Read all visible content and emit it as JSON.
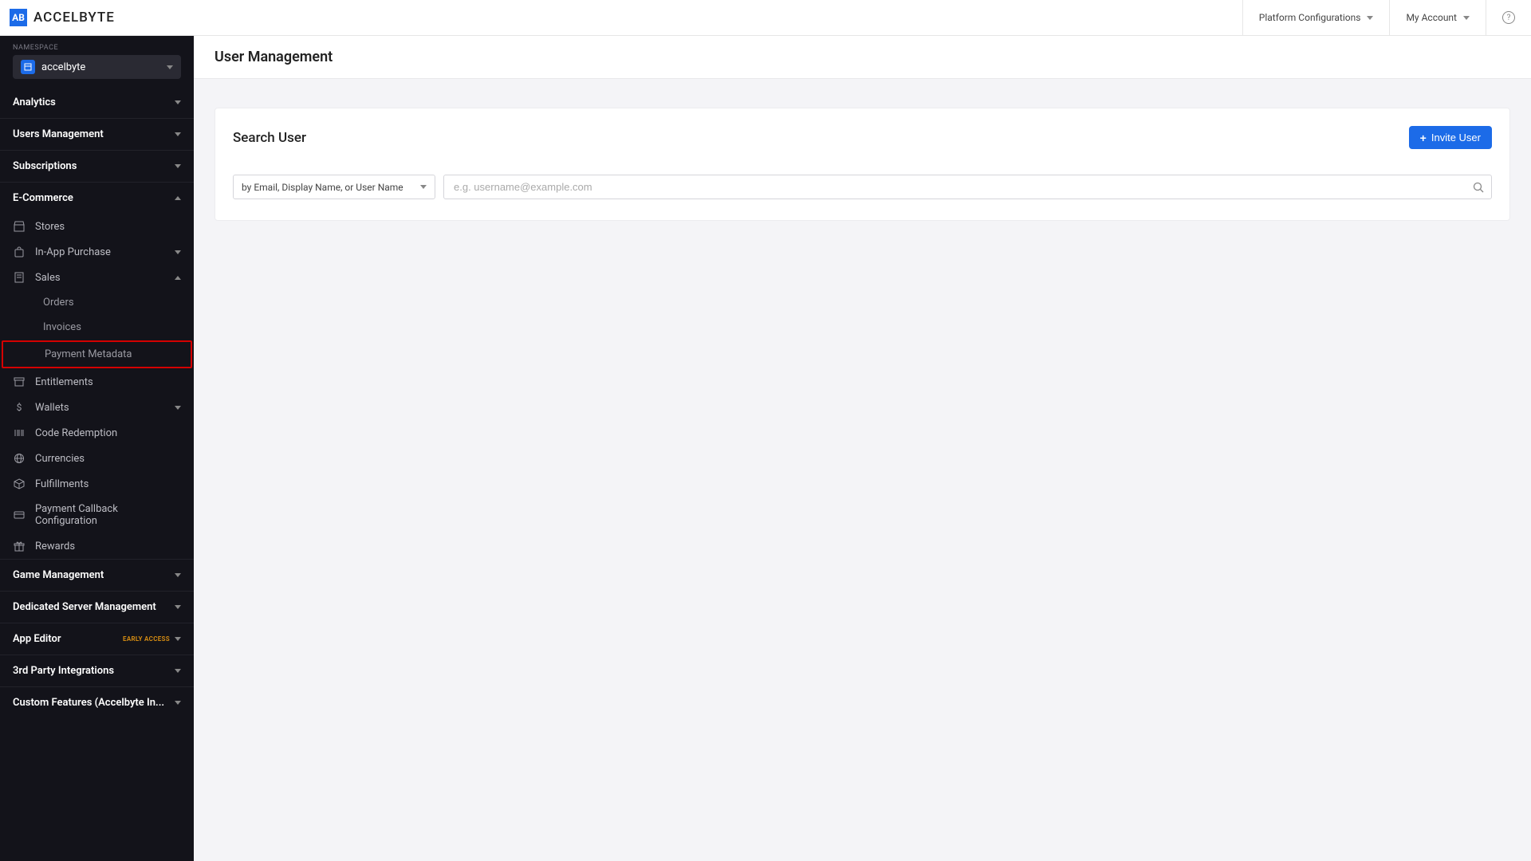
{
  "brand": {
    "name": "ACCELBYTE",
    "logo_letters": "AB"
  },
  "topbar": {
    "platform_configs": "Platform Configurations",
    "my_account": "My Account"
  },
  "sidebar": {
    "namespace_label": "NAMESPACE",
    "namespace_value": "accelbyte",
    "sections": {
      "analytics": "Analytics",
      "users_management": "Users Management",
      "subscriptions": "Subscriptions",
      "ecommerce": "E-Commerce",
      "game_management": "Game Management",
      "dedicated_server": "Dedicated Server Management",
      "app_editor": "App Editor",
      "app_editor_badge": "EARLY ACCESS",
      "third_party": "3rd Party Integrations",
      "custom_features": "Custom Features (Accelbyte In..."
    },
    "ecommerce_items": {
      "stores": "Stores",
      "in_app_purchase": "In-App Purchase",
      "sales": "Sales",
      "orders": "Orders",
      "invoices": "Invoices",
      "payment_metadata": "Payment Metadata",
      "entitlements": "Entitlements",
      "wallets": "Wallets",
      "code_redemption": "Code Redemption",
      "currencies": "Currencies",
      "fulfillments": "Fulfillments",
      "payment_callback": "Payment Callback Configuration",
      "rewards": "Rewards"
    }
  },
  "page": {
    "title": "User Management",
    "card_title": "Search User",
    "invite_button": "Invite User",
    "search_type_selected": "by Email, Display Name, or User Name",
    "search_placeholder": "e.g. username@example.com"
  },
  "colors": {
    "primary": "#1c6be8",
    "highlight_border": "#d40000",
    "sidebar_bg": "#13131a"
  }
}
